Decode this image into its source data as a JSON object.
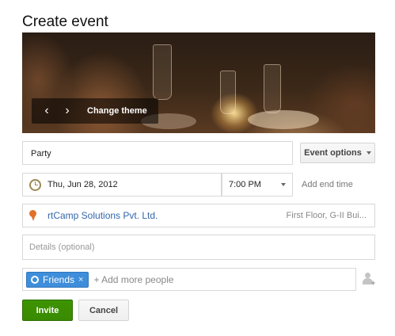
{
  "page": {
    "title": "Create event"
  },
  "banner": {
    "change_theme_label": "Change theme",
    "prev_icon": "chevron-left-icon",
    "next_icon": "chevron-right-icon"
  },
  "form": {
    "event_name_value": "Party",
    "event_options_label": "Event options",
    "date_value": "Thu, Jun 28, 2012",
    "time_value": "7:00 PM",
    "add_end_time_label": "Add end time",
    "location_name": "rtCamp Solutions Pvt. Ltd.",
    "location_address": "First Floor, G-II Bui...",
    "details_placeholder": "Details (optional)",
    "guest_chip_label": "Friends",
    "guest_chip_remove": "×",
    "add_people_placeholder": "+ Add more people"
  },
  "actions": {
    "invite_label": "Invite",
    "cancel_label": "Cancel"
  },
  "colors": {
    "invite_green": "#3d9400",
    "chip_blue": "#3f8edb",
    "link_blue": "#3366aa",
    "pin_orange": "#e0702a"
  }
}
